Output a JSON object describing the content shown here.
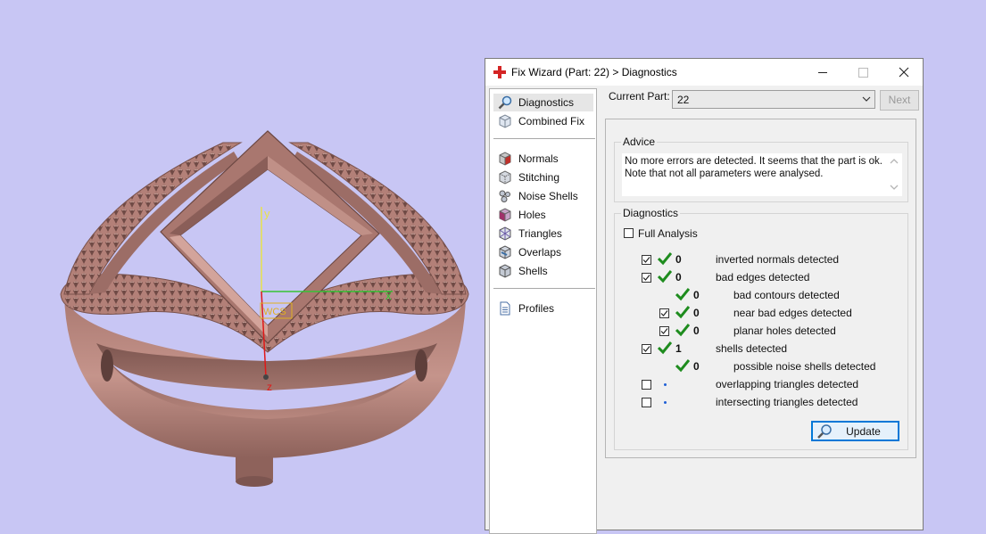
{
  "viewport": {
    "axis_labels": {
      "x": "x",
      "y": "y",
      "z": "z"
    },
    "wcs_label": "WCS"
  },
  "window": {
    "title": "Fix Wizard (Part: 22) > Diagnostics",
    "title_icon": "red-cross-icon"
  },
  "nav": {
    "items": [
      {
        "label": "Diagnostics",
        "icon": "magnifier-icon",
        "selected": true
      },
      {
        "label": "Combined Fix",
        "icon": "cube-icon"
      },
      {
        "label": "Normals",
        "icon": "normals-cube-icon"
      },
      {
        "label": "Stitching",
        "icon": "stitching-cube-icon"
      },
      {
        "label": "Noise Shells",
        "icon": "noise-shells-icon"
      },
      {
        "label": "Holes",
        "icon": "holes-cube-icon"
      },
      {
        "label": "Triangles",
        "icon": "triangles-cube-icon"
      },
      {
        "label": "Overlaps",
        "icon": "overlaps-cube-icon"
      },
      {
        "label": "Shells",
        "icon": "shells-cube-icon"
      },
      {
        "label": "Profiles",
        "icon": "document-icon"
      }
    ]
  },
  "current_part": {
    "label": "Current Part:",
    "value": "22"
  },
  "next_label": "Next",
  "advice": {
    "title": "Advice",
    "lines": [
      "No more errors are detected. It seems that the part is ok.",
      "Note that not all parameters were analysed."
    ]
  },
  "diagnostics": {
    "title": "Diagnostics",
    "full_analysis_label": "Full Analysis",
    "rows": [
      {
        "checkbox": true,
        "checked": true,
        "status": "ok",
        "count": "0",
        "label": "inverted normals detected"
      },
      {
        "checkbox": true,
        "checked": true,
        "status": "ok",
        "count": "0",
        "label": "bad edges detected"
      },
      {
        "checkbox": false,
        "status": "ok",
        "count": "0",
        "label": "bad contours detected"
      },
      {
        "checkbox": true,
        "checked": true,
        "status": "ok",
        "count": "0",
        "label": "near bad edges detected"
      },
      {
        "checkbox": true,
        "checked": true,
        "status": "ok",
        "count": "0",
        "label": "planar holes detected"
      },
      {
        "checkbox": true,
        "checked": true,
        "status": "ok",
        "count": "1",
        "label": "shells detected"
      },
      {
        "checkbox": false,
        "status": "ok",
        "count": "0",
        "label": "possible noise shells detected"
      },
      {
        "checkbox": true,
        "checked": false,
        "status": "none",
        "count": "",
        "label": "overlapping triangles detected"
      },
      {
        "checkbox": true,
        "checked": false,
        "status": "none",
        "count": "",
        "label": "intersecting triangles detected"
      }
    ]
  },
  "update_label": "Update",
  "colors": {
    "background": "#c8c6f4",
    "ring": "#b5847c",
    "check_green": "#1e8c1e",
    "accent_blue": "#0078d7"
  }
}
